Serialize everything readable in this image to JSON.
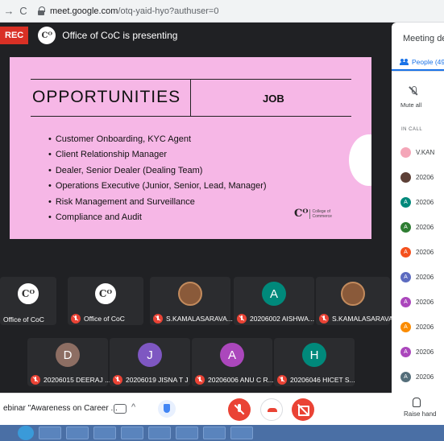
{
  "browser": {
    "url_host": "meet.google.com",
    "url_path": "/otq-yaid-hyo?authuser=0"
  },
  "meet_header": {
    "rec_label": "REC",
    "presenter_badge": "Cᴼ",
    "presenting_text": "Office of CoC is presenting"
  },
  "slide": {
    "title": "OPPORTUNITIES",
    "column_header": "JOB",
    "items": [
      "Customer Onboarding, KYC Agent",
      "Client Relationship Manager",
      "Dealer, Senior Dealer (Dealing Team)",
      "Operations Executive (Junior, Senior, Lead, Manager)",
      "Risk Management and Surveillance",
      "Compliance and Audit"
    ],
    "logo_mark": "Cᴼ",
    "logo_text_1": "College of",
    "logo_text_2": "Commerce"
  },
  "tiles": {
    "row1": [
      {
        "initial": "Cᴼ",
        "name": "Office of CoC",
        "muted": false
      },
      {
        "initial": "Cᴼ",
        "name": "Office of CoC",
        "muted": true
      },
      {
        "initial": "",
        "name": "S.KAMALASARAVA...",
        "muted": true
      },
      {
        "initial": "A",
        "name": "20206002 AISHWA...",
        "muted": true
      },
      {
        "initial": "",
        "name": "S.KAMALASARAVA...",
        "muted": true
      }
    ],
    "row2": [
      {
        "initial": "D",
        "name": "20206015 DEERAJ ...",
        "muted": true
      },
      {
        "initial": "J",
        "name": "20206019 JISNA T J",
        "muted": true
      },
      {
        "initial": "A",
        "name": "20206006 ANU C R...",
        "muted": true
      },
      {
        "initial": "H",
        "name": "20206046 HICET S...",
        "muted": true
      }
    ]
  },
  "colors": {
    "slide_bg": "#f6b7e6",
    "tile_d": "#8d6e63",
    "tile_j": "#7e57c2",
    "tile_a_purple": "#ab47bc",
    "tile_a_teal": "#00897b",
    "tile_h": "#00897b",
    "alert": "#ea4335",
    "accent": "#1a73e8"
  },
  "panel": {
    "title": "Meeting de",
    "people_tab": "People (49",
    "mute_all": "Mute all",
    "in_call": "IN CALL",
    "people": [
      {
        "initial": "",
        "name": "V.KAN",
        "color": "#f4a6b8"
      },
      {
        "initial": "",
        "name": "20206",
        "color": "#5d4037"
      },
      {
        "initial": "A",
        "name": "20206",
        "color": "#00897b"
      },
      {
        "initial": "A",
        "name": "20206",
        "color": "#2e7d32"
      },
      {
        "initial": "A",
        "name": "20206",
        "color": "#f4511e"
      },
      {
        "initial": "A",
        "name": "20206",
        "color": "#5c6bc0"
      },
      {
        "initial": "A",
        "name": "20206",
        "color": "#ab47bc"
      },
      {
        "initial": "A",
        "name": "20206",
        "color": "#fb8c00"
      },
      {
        "initial": "A",
        "name": "20206",
        "color": "#ab47bc"
      },
      {
        "initial": "A",
        "name": "20206",
        "color": "#546e7a"
      }
    ],
    "raise_hand": "Raise hand"
  },
  "bottom": {
    "meeting_name": "ebinar \"Awareness on Career ...",
    "chevron": "^"
  }
}
